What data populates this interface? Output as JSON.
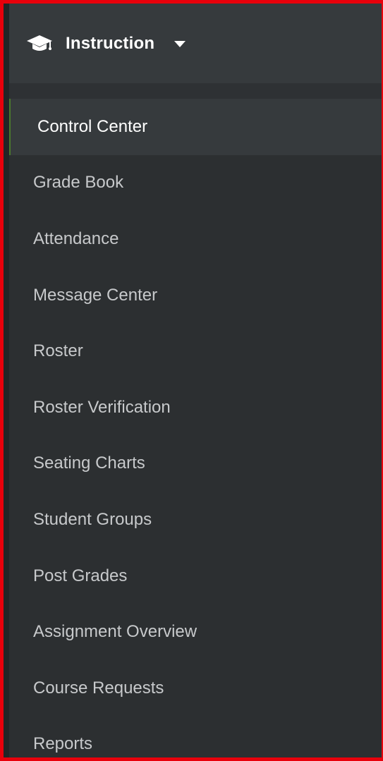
{
  "header": {
    "icon": "graduation-cap-icon",
    "title": "Instruction",
    "caret_icon": "caret-down-icon"
  },
  "menu": {
    "active_index": 0,
    "items": [
      {
        "label": "Control Center"
      },
      {
        "label": "Grade Book"
      },
      {
        "label": "Attendance"
      },
      {
        "label": "Message Center"
      },
      {
        "label": "Roster"
      },
      {
        "label": "Roster Verification"
      },
      {
        "label": "Seating Charts"
      },
      {
        "label": "Student Groups"
      },
      {
        "label": "Post Grades"
      },
      {
        "label": "Assignment Overview"
      },
      {
        "label": "Course Requests"
      },
      {
        "label": "Reports"
      }
    ]
  },
  "colors": {
    "frame_border": "#e8000b",
    "panel_bg": "#2c2f31",
    "header_bg": "#363a3d",
    "active_bg": "#363a3d",
    "text": "#c7c9cb",
    "active_text": "#ffffff"
  }
}
